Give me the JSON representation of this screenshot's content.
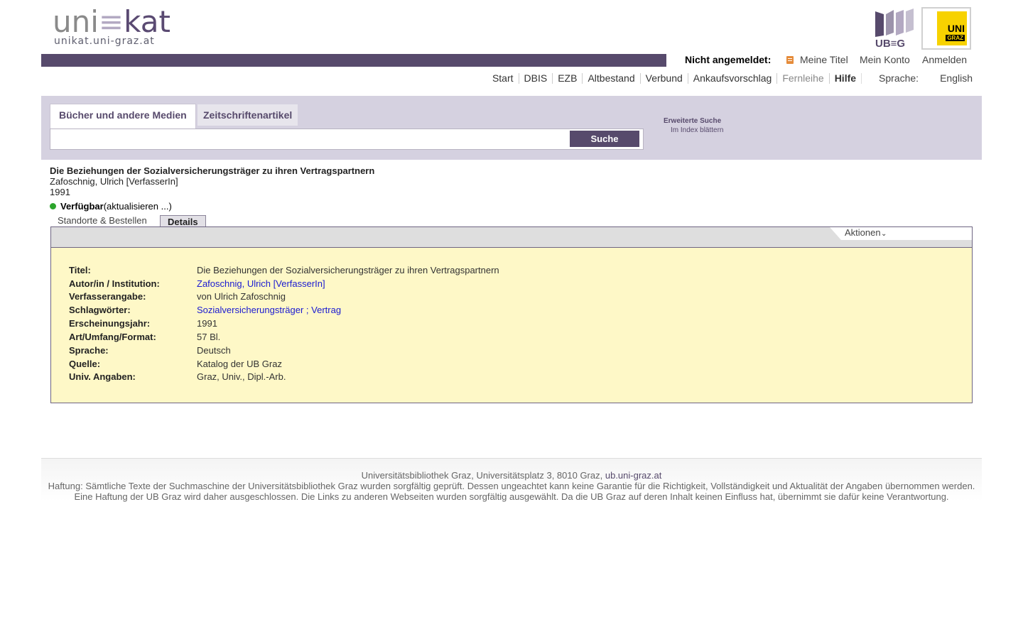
{
  "header": {
    "logo_main_left": "uni",
    "logo_main_e": "≡",
    "logo_main_right": "kat",
    "logo_sub": "unikat.uni-graz.at",
    "ub_logo_text": "UB≡G",
    "uni_logo_line1": "UNI",
    "uni_logo_line2": "GRAZ"
  },
  "login": {
    "status": "Nicht angemeldet:",
    "meine_titel": "Meine Titel",
    "mein_konto": "Mein Konto",
    "anmelden": "Anmelden"
  },
  "nav": {
    "items": [
      "Start",
      "DBIS",
      "EZB",
      "Altbestand",
      "Verbund",
      "Ankaufsvorschlag",
      "Fernleihe",
      "Hilfe"
    ],
    "language_label": "Sprache:",
    "language_value": "English"
  },
  "search": {
    "tab_books": "Bücher und andere Medien",
    "tab_articles": "Zeitschriftenartikel",
    "query": "",
    "button": "Suche",
    "advanced": "Erweiterte Suche",
    "index": "Im Index blättern"
  },
  "record": {
    "title": "Die Beziehungen der Sozialversicherungsträger zu ihren Vertragspartnern",
    "author": "Zafoschnig, Ulrich [VerfasserIn]",
    "year": "1991",
    "availability": "Verfügbar",
    "refresh": "(aktualisieren ...)",
    "tab_locations": "Standorte & Bestellen",
    "tab_details": "Details",
    "actions": "Aktionen",
    "status_color": "#2ca52c"
  },
  "details": {
    "titel_label": "Titel:",
    "titel": "Die Beziehungen der Sozialversicherungsträger zu ihren Vertragspartnern",
    "autor_label": "Autor/in / Institution:",
    "autor": "Zafoschnig, Ulrich [VerfasserIn]",
    "verfasserangabe_label": "Verfasserangabe:",
    "verfasserangabe": "von Ulrich Zafoschnig",
    "schlagwoerter_label": "Schlagwörter:",
    "schlagwort1": "Sozialversicherungsträger",
    "schlagwort_sep": " ; ",
    "schlagwort2": "Vertrag",
    "jahr_label": "Erscheinungsjahr:",
    "jahr": "1991",
    "umfang_label": "Art/Umfang/Format:",
    "umfang": "57 Bl.",
    "sprache_label": "Sprache:",
    "sprache": "Deutsch",
    "quelle_label": "Quelle:",
    "quelle": "Katalog der UB Graz",
    "univ_label": "Univ. Angaben:",
    "univ": "Graz, Univ., Dipl.-Arb."
  },
  "footer": {
    "address": "Universitätsbibliothek Graz, Universitätsplatz 3, 8010 Graz,",
    "link": "ub.uni-graz.at",
    "line2": "Haftung: Sämtliche Texte der Suchmaschine der Universitätsbibliothek Graz wurden sorgfältig geprüft. Dessen ungeachtet kann keine Garantie für die Richtigkeit, Vollständigkeit und Aktualität der Angaben übernommen werden.",
    "line3": "Eine Haftung der UB Graz wird daher ausgeschlossen. Die Links zu anderen Webseiten wurden sorgfältig ausgewählt. Da die UB Graz auf deren Inhalt keinen Einfluss hat, übernimmt sie dafür keine Verantwortung."
  },
  "colors": {
    "brand_purple": "#574a6c",
    "panel_lilac": "#d5d1e0",
    "details_yellow": "#fef8c7",
    "link_blue": "#1a1ad1"
  }
}
